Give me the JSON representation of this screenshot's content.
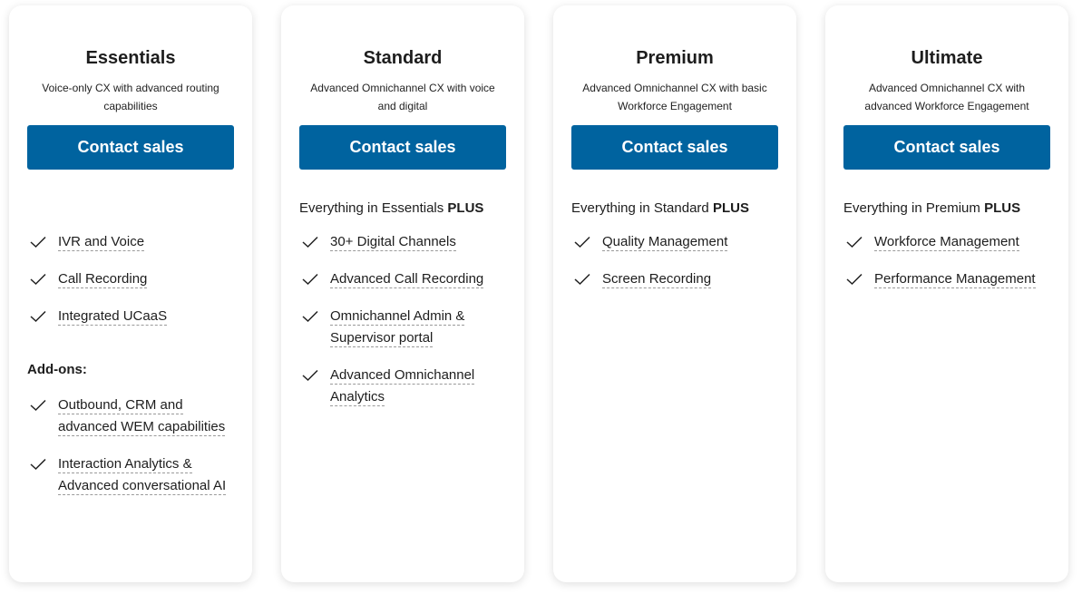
{
  "colors": {
    "accent": "#00639f"
  },
  "icons": {
    "feature": "check-icon"
  },
  "plans": [
    {
      "name": "Essentials",
      "description": "Voice-only CX with advanced routing capabilities",
      "cta": "Contact sales",
      "plus_prefix": "",
      "plus_bold": "",
      "features": [
        "IVR and Voice",
        "Call Recording",
        "Integrated UCaaS"
      ],
      "addons_label": "Add-ons:",
      "addons": [
        "Outbound, CRM and advanced WEM capabilities",
        "Interaction Analytics & Advanced conversational AI"
      ]
    },
    {
      "name": "Standard",
      "description": "Advanced Omnichannel CX with voice and digital",
      "cta": "Contact sales",
      "plus_prefix": "Everything in Essentials ",
      "plus_bold": "PLUS",
      "features": [
        "30+ Digital Channels",
        "Advanced Call Recording",
        "Omnichannel Admin & Supervisor portal",
        "Advanced Omnichannel Analytics"
      ]
    },
    {
      "name": "Premium",
      "description": "Advanced Omnichannel CX with basic Workforce Engagement",
      "cta": "Contact sales",
      "plus_prefix": "Everything in Standard ",
      "plus_bold": "PLUS",
      "features": [
        "Quality Management",
        "Screen Recording"
      ]
    },
    {
      "name": "Ultimate",
      "description": "Advanced Omnichannel CX with advanced Workforce Engagement",
      "cta": "Contact sales",
      "plus_prefix": "Everything in Premium ",
      "plus_bold": "PLUS",
      "features": [
        "Workforce Management",
        "Performance Management"
      ]
    }
  ]
}
